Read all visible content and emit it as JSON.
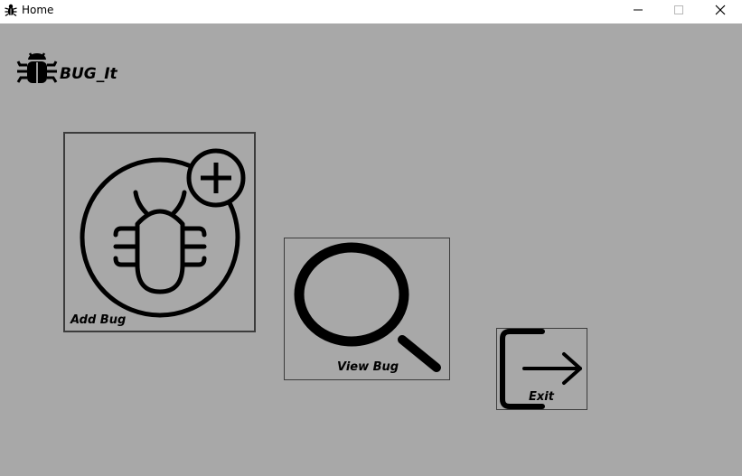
{
  "window": {
    "title": "Home",
    "background": "#a8a8a8",
    "controls": {
      "minimize_icon": "minimize-icon",
      "maximize_icon": "maximize-icon",
      "close_icon": "close-icon"
    }
  },
  "brand": {
    "name": "BUG_It",
    "icon": "bug-icon"
  },
  "actions": {
    "add_bug": {
      "label": "Add Bug",
      "icon": "add-bug-icon"
    },
    "view_bug": {
      "label": "View Bug",
      "icon": "magnifier-icon"
    },
    "exit": {
      "label": "Exit",
      "icon": "exit-icon"
    }
  }
}
